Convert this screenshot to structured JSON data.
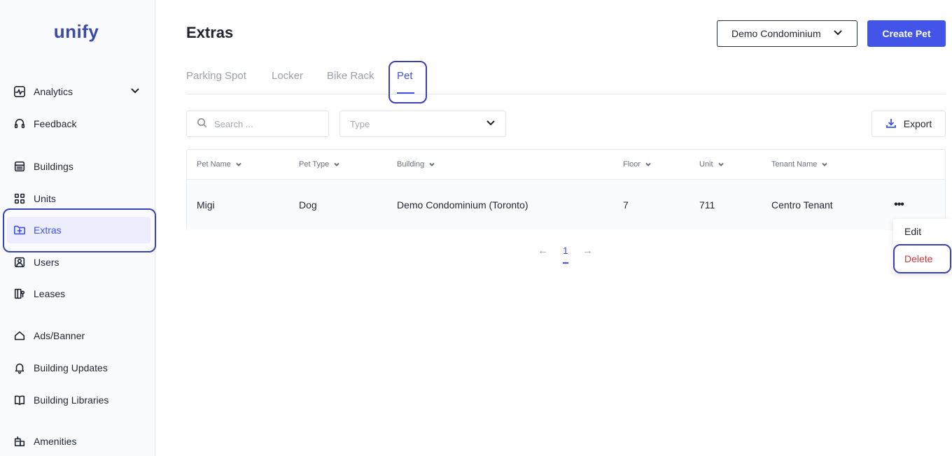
{
  "brand": {
    "logo_text": "unify"
  },
  "sidebar": {
    "items": [
      {
        "label": "Analytics"
      },
      {
        "label": "Feedback"
      },
      {
        "label": "Buildings"
      },
      {
        "label": "Units"
      },
      {
        "label": "Extras"
      },
      {
        "label": "Users"
      },
      {
        "label": "Leases"
      },
      {
        "label": "Ads/Banner"
      },
      {
        "label": "Building Updates"
      },
      {
        "label": "Building Libraries"
      },
      {
        "label": "Amenities"
      }
    ],
    "active": "Extras"
  },
  "header": {
    "title": "Extras",
    "building_select": "Demo Condominium",
    "create_button": "Create Pet"
  },
  "tabs": [
    {
      "label": "Parking Spot"
    },
    {
      "label": "Locker"
    },
    {
      "label": "Bike Rack"
    },
    {
      "label": "Pet"
    }
  ],
  "active_tab": "Pet",
  "filters": {
    "search_placeholder": "Search ...",
    "type_placeholder": "Type",
    "export_label": "Export"
  },
  "table": {
    "columns": [
      "Pet Name",
      "Pet Type",
      "Building",
      "Floor",
      "Unit",
      "Tenant Name"
    ],
    "rows": [
      [
        "Migi",
        "Dog",
        "Demo Condominium (Toronto)",
        "7",
        "711",
        "Centro Tenant"
      ]
    ]
  },
  "pagination": {
    "prev": "←",
    "current": "1",
    "next": "→"
  },
  "row_menu": {
    "edit": "Edit",
    "delete": "Delete"
  },
  "colors": {
    "accent": "#3f51e5",
    "danger": "#c93b3b",
    "highlight": "#3b3fb8"
  }
}
